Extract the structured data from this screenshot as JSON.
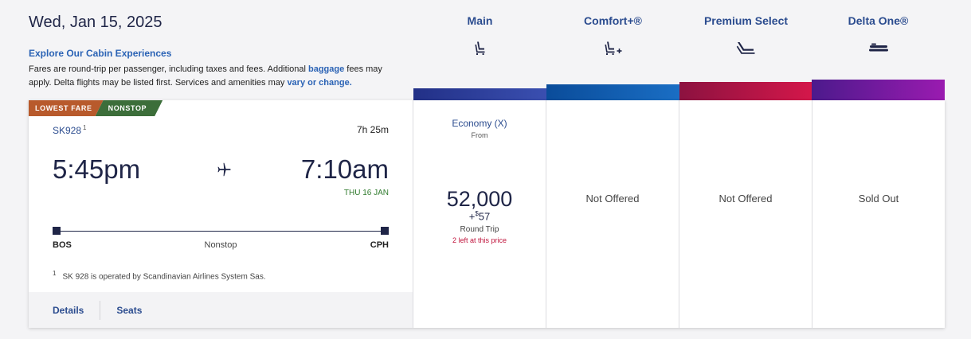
{
  "header": {
    "date": "Wed, Jan 15, 2025",
    "explore_link": "Explore Our Cabin Experiences",
    "note_part1": "Fares are round-trip per passenger, including taxes and fees. Additional ",
    "note_link1": "baggage",
    "note_part2": " fees may apply. Delta flights may be listed first. Services and amenities may ",
    "note_link2": "vary or change."
  },
  "cabins": [
    {
      "name": "Main",
      "icon": "seat-icon",
      "bar_color": "#2a3a8c"
    },
    {
      "name": "Comfort+®",
      "icon": "seat-plus-icon",
      "bar_color": "#0f5aa8"
    },
    {
      "name": "Premium Select",
      "icon": "recliner-icon",
      "bar_color": "#b0143f"
    },
    {
      "name": "Delta One®",
      "icon": "flatbed-icon",
      "bar_color": "#6a1fa3"
    }
  ],
  "flight": {
    "badges": [
      "LOWEST FARE",
      "NONSTOP"
    ],
    "number": "SK928",
    "footnote_marker": "1",
    "duration": "7h 25m",
    "depart_time": "5:45pm",
    "arrive_time": "7:10am",
    "arrive_date": "THU 16 JAN",
    "origin": "BOS",
    "destination": "CPH",
    "stops": "Nonstop",
    "footnote": "SK 928 is operated by Scandinavian Airlines System Sas.",
    "links": [
      "Details",
      "Seats"
    ]
  },
  "fares": {
    "main": {
      "class": "Economy (X)",
      "from": "From",
      "miles": "52,000",
      "tax_prefix": "+",
      "tax_currency": "$",
      "tax_amount": "57",
      "trip_type": "Round Trip",
      "availability": "2 left at this price"
    },
    "comfort": "Not Offered",
    "premium": "Not Offered",
    "delta_one": "Sold Out"
  }
}
